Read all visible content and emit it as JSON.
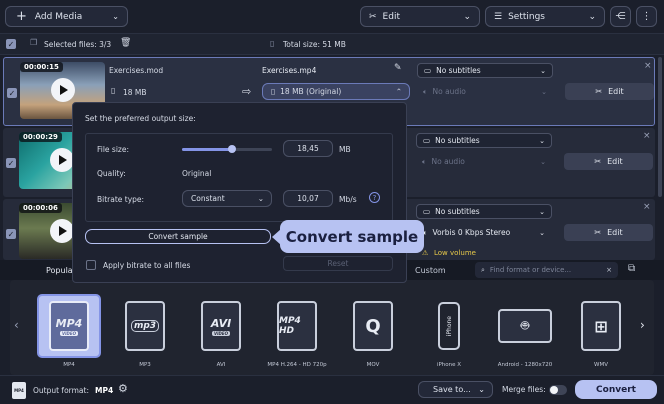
{
  "toolbar": {
    "add_media": "Add Media",
    "edit": "Edit",
    "settings": "Settings"
  },
  "selection": {
    "selected_label": "Selected files: 3/3",
    "total_size": "Total size: 51 MB"
  },
  "files": [
    {
      "duration": "00:00:15",
      "name": "Exercises.mod",
      "size": "18 MB",
      "output_name": "Exercises.mp4",
      "output_size": "18 MB (Original)",
      "subtitles": "No subtitles",
      "audio": "No audio",
      "edit": "Edit"
    },
    {
      "duration": "00:00:29",
      "subtitles": "No subtitles",
      "audio": "No audio",
      "edit": "Edit"
    },
    {
      "duration": "00:00:06",
      "subtitles": "No subtitles",
      "audio": "Vorbis 0 Kbps Stereo",
      "warning": "Low volume",
      "edit": "Edit"
    }
  ],
  "popup": {
    "title": "Set the preferred output size:",
    "file_size_label": "File size:",
    "file_size_value": "18,45",
    "file_size_unit": "MB",
    "slider_fraction": 0.55,
    "quality_label": "Quality:",
    "quality_value": "Original",
    "bitrate_type_label": "Bitrate type:",
    "bitrate_type_value": "Constant",
    "bitrate_value": "10,07",
    "bitrate_unit": "Mb/s",
    "convert_sample": "Convert sample",
    "apply_bitrate": "Apply bitrate to all files",
    "reset": "Reset"
  },
  "tooltip": "Convert sample",
  "format_tabs": {
    "popular": "Popular",
    "custom": "Custom",
    "search_placeholder": "Find format or device..."
  },
  "formats": [
    {
      "icon": "MP4",
      "label": "MP4"
    },
    {
      "icon": "mp3",
      "label": "MP3"
    },
    {
      "icon": "AVI",
      "label": "AVI"
    },
    {
      "icon": "MP4 HD",
      "label": "MP4 H.264 - HD 720p"
    },
    {
      "icon": "MOV",
      "label": "MOV"
    },
    {
      "icon": "iPhone",
      "label": "iPhone X"
    },
    {
      "icon": "Android",
      "label": "Android - 1280x720"
    },
    {
      "icon": "WMV",
      "label": "WMV"
    }
  ],
  "bottom": {
    "output_format_label": "Output format:",
    "output_format_value": "MP4",
    "save_to": "Save to...",
    "merge_files": "Merge files:",
    "convert": "Convert"
  }
}
